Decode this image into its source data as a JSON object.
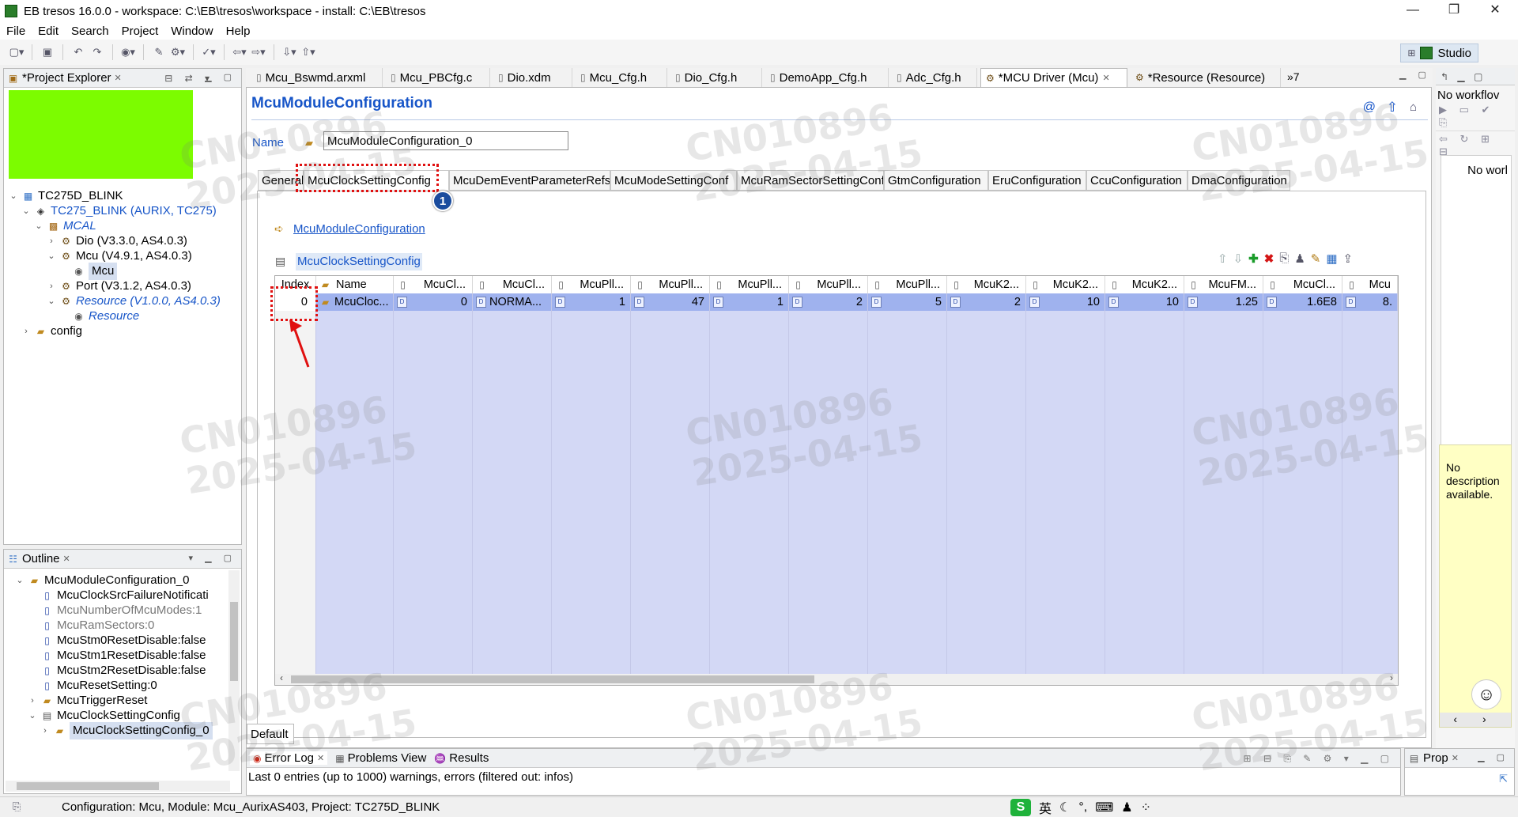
{
  "window": {
    "title": "EB tresos 16.0.0 - workspace: C:\\EB\\tresos\\workspace - install: C:\\EB\\tresos",
    "controls": [
      "—",
      "❐",
      "✕"
    ]
  },
  "menu": [
    "File",
    "Edit",
    "Search",
    "Project",
    "Window",
    "Help"
  ],
  "perspective": {
    "label": "Studio"
  },
  "project_explorer": {
    "title": "*Project Explorer",
    "tree": [
      {
        "label": "TC275D_BLINK",
        "icon": "project-icon",
        "indent": 0,
        "twisty": "open",
        "style": "normal"
      },
      {
        "label": "TC275_BLINK (AURIX, TC275)",
        "icon": "ecu-icon",
        "indent": 1,
        "twisty": "open",
        "style": "blue"
      },
      {
        "label": "MCAL",
        "icon": "mcal-icon",
        "indent": 2,
        "twisty": "open",
        "style": "blue-italic"
      },
      {
        "label": "Dio (V3.3.0, AS4.0.3)",
        "icon": "module-icon",
        "indent": 3,
        "twisty": "closed",
        "style": "normal"
      },
      {
        "label": "Mcu (V4.9.1, AS4.0.3)",
        "icon": "module-icon",
        "indent": 3,
        "twisty": "open",
        "style": "normal"
      },
      {
        "label": "Mcu",
        "icon": "config-icon",
        "indent": 4,
        "twisty": "",
        "style": "selected"
      },
      {
        "label": "Port (V3.1.2, AS4.0.3)",
        "icon": "module-icon",
        "indent": 3,
        "twisty": "closed",
        "style": "normal"
      },
      {
        "label": "Resource (V1.0.0, AS4.0.3)",
        "icon": "module-icon",
        "indent": 3,
        "twisty": "open",
        "style": "blue-italic"
      },
      {
        "label": "Resource",
        "icon": "config-icon",
        "indent": 4,
        "twisty": "",
        "style": "blue-italic"
      },
      {
        "label": "config",
        "icon": "folder-icon",
        "indent": 1,
        "twisty": "closed",
        "style": "normal"
      }
    ]
  },
  "outline": {
    "title": "Outline",
    "tree": [
      {
        "label": "McuModuleConfiguration_0",
        "icon": "folder-icon",
        "indent": 0,
        "twisty": "open",
        "style": "normal"
      },
      {
        "label": "McuClockSrcFailureNotificati",
        "icon": "param-icon",
        "indent": 1,
        "twisty": "",
        "style": "normal"
      },
      {
        "label": "McuNumberOfMcuModes:1",
        "icon": "param-icon",
        "indent": 1,
        "twisty": "",
        "style": "grey"
      },
      {
        "label": "McuRamSectors:0",
        "icon": "param-icon",
        "indent": 1,
        "twisty": "",
        "style": "grey"
      },
      {
        "label": "McuStm0ResetDisable:false",
        "icon": "param-icon",
        "indent": 1,
        "twisty": "",
        "style": "normal"
      },
      {
        "label": "McuStm1ResetDisable:false",
        "icon": "param-icon",
        "indent": 1,
        "twisty": "",
        "style": "normal"
      },
      {
        "label": "McuStm2ResetDisable:false",
        "icon": "param-icon",
        "indent": 1,
        "twisty": "",
        "style": "normal"
      },
      {
        "label": "McuResetSetting:0",
        "icon": "param-icon",
        "indent": 1,
        "twisty": "",
        "style": "normal"
      },
      {
        "label": "McuTriggerReset",
        "icon": "folder-icon",
        "indent": 1,
        "twisty": "closed",
        "style": "normal"
      },
      {
        "label": "McuClockSettingConfig",
        "icon": "list-icon",
        "indent": 1,
        "twisty": "open",
        "style": "normal"
      },
      {
        "label": "McuClockSettingConfig_0",
        "icon": "folder-icon",
        "indent": 2,
        "twisty": "closed",
        "style": "selected"
      }
    ]
  },
  "editor_tabs": [
    {
      "label": "Mcu_Bswmd.arxml",
      "icon": "file-icon",
      "active": false
    },
    {
      "label": "Mcu_PBCfg.c",
      "icon": "file-icon",
      "active": false
    },
    {
      "label": "Dio.xdm",
      "icon": "file-icon",
      "active": false
    },
    {
      "label": "Mcu_Cfg.h",
      "icon": "file-icon",
      "active": false
    },
    {
      "label": "Dio_Cfg.h",
      "icon": "file-icon",
      "active": false
    },
    {
      "label": "DemoApp_Cfg.h",
      "icon": "file-icon",
      "active": false
    },
    {
      "label": "Adc_Cfg.h",
      "icon": "file-icon",
      "active": false
    },
    {
      "label": "*MCU Driver (Mcu)",
      "icon": "module-icon",
      "active": true
    },
    {
      "label": "*Resource (Resource)",
      "icon": "module-icon",
      "active": false
    }
  ],
  "editor_tabs_overflow": "»7",
  "editor": {
    "heading": "McuModuleConfiguration",
    "name_label": "Name",
    "name_value": "McuModuleConfiguration_0",
    "config_tabs": [
      "General",
      "McuClockSettingConfig",
      "McuDemEventParameterRefs",
      "McuModeSettingConf",
      "McuRamSectorSettingConf",
      "GtmConfiguration",
      "EruConfiguration",
      "CcuConfiguration",
      "DmaConfiguration"
    ],
    "active_config_tab": "McuClockSettingConfig",
    "breadcrumb_link": "McuModuleConfiguration",
    "table_title": "McuClockSettingConfig",
    "table": {
      "headers": [
        "Index",
        "Name",
        "McuCl...",
        "McuCl...",
        "McuPll...",
        "McuPll...",
        "McuPll...",
        "McuPll...",
        "McuPll...",
        "McuK2...",
        "McuK2...",
        "McuK2...",
        "McuFM...",
        "McuCl...",
        "Mcu"
      ],
      "rows": [
        [
          "0",
          "McuCloc...",
          "0",
          "NORMA...",
          "1",
          "47",
          "1",
          "2",
          "5",
          "2",
          "10",
          "10",
          "1.25",
          "1.6E8",
          "8."
        ]
      ]
    },
    "bottom_tab": "Default"
  },
  "annotations": {
    "step_badge": "1"
  },
  "watermarks": [
    {
      "line1": "CN010896",
      "line2": "2025-04-15"
    }
  ],
  "right_panel": {
    "workflow_text": "No workflov",
    "worl_text": "No worl",
    "description": "No description available."
  },
  "bottom_panel": {
    "tabs": [
      {
        "label": "Error Log",
        "icon": "error-log-icon"
      },
      {
        "label": "Problems View",
        "icon": "problems-icon"
      },
      {
        "label": "Results",
        "icon": "results-icon"
      }
    ],
    "status_line": "Last 0 entries (up to 1000) warnings, errors (filtered out: infos)"
  },
  "prop_panel": {
    "title": "Prop"
  },
  "statusbar": {
    "text": "Configuration: Mcu, Module: Mcu_AurixAS403, Project: TC275D_BLINK",
    "ime": [
      "英",
      "☾",
      "°,",
      "⌨",
      "♟",
      "⁘"
    ]
  },
  "colors": {
    "accent_blue": "#1755c8",
    "selection_row": "#9fb2ee",
    "table_grid_bg": "#d3d8f5",
    "highlight_green": "#7cfc00",
    "annotation_red": "#e01010"
  }
}
